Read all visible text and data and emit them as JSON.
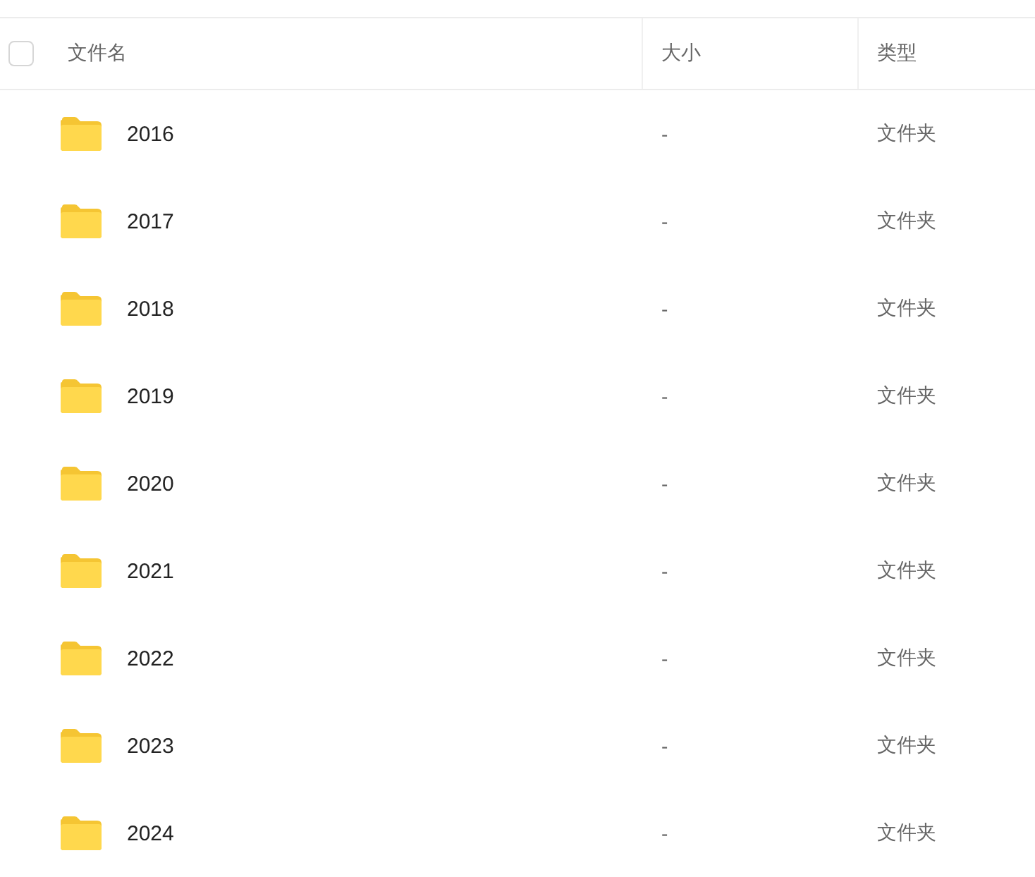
{
  "table": {
    "select_all": {
      "checked": false
    },
    "columns": [
      "文件名",
      "大小",
      "类型"
    ],
    "rows": [
      {
        "kind": "folder",
        "name": "2016",
        "size": "-",
        "type": "文件夹"
      },
      {
        "kind": "folder",
        "name": "2017",
        "size": "-",
        "type": "文件夹"
      },
      {
        "kind": "folder",
        "name": "2018",
        "size": "-",
        "type": "文件夹"
      },
      {
        "kind": "folder",
        "name": "2019",
        "size": "-",
        "type": "文件夹"
      },
      {
        "kind": "folder",
        "name": "2020",
        "size": "-",
        "type": "文件夹"
      },
      {
        "kind": "folder",
        "name": "2021",
        "size": "-",
        "type": "文件夹"
      },
      {
        "kind": "folder",
        "name": "2022",
        "size": "-",
        "type": "文件夹"
      },
      {
        "kind": "folder",
        "name": "2023",
        "size": "-",
        "type": "文件夹"
      },
      {
        "kind": "folder",
        "name": "2024",
        "size": "-",
        "type": "文件夹"
      }
    ]
  }
}
